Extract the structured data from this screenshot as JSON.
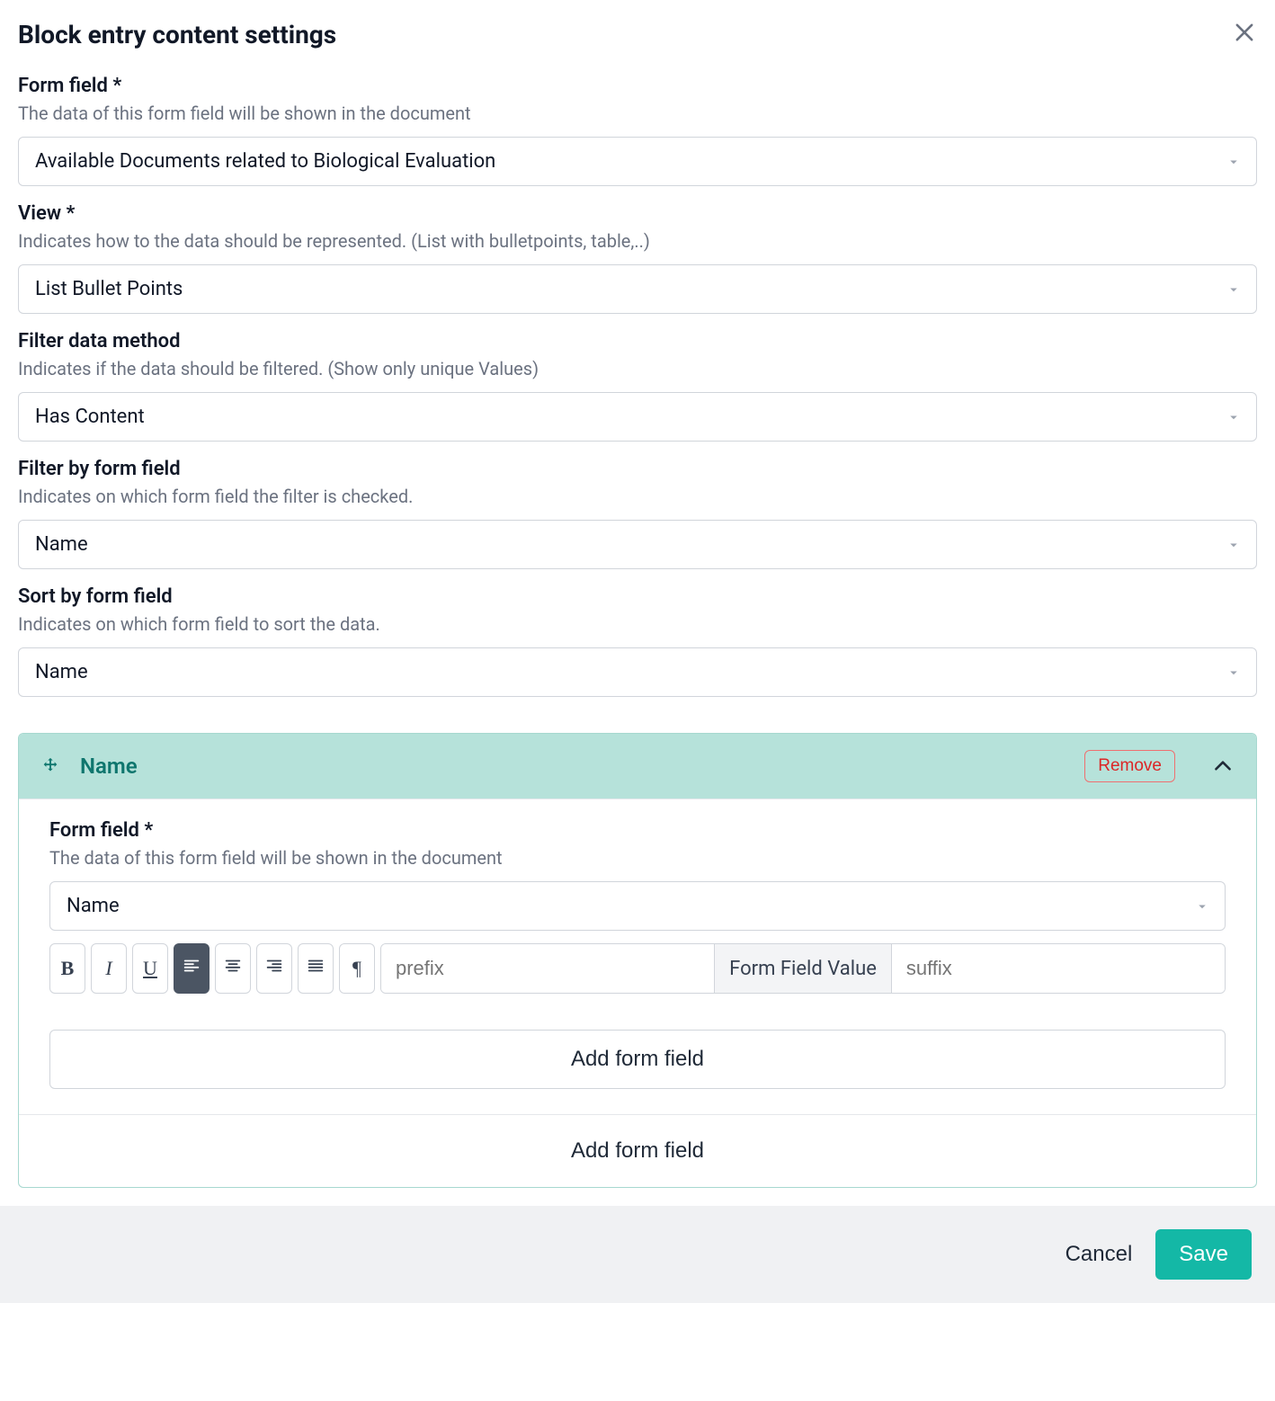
{
  "header": {
    "title": "Block entry content settings"
  },
  "fields": {
    "form_field": {
      "label": "Form field *",
      "desc": "The data of this form field will be shown in the document",
      "value": "Available Documents related to Biological Evaluation"
    },
    "view": {
      "label": "View *",
      "desc": "Indicates how to the data should be represented. (List with bulletpoints, table,..)",
      "value": "List Bullet Points"
    },
    "filter_method": {
      "label": "Filter data method",
      "desc": "Indicates if the data should be filtered. (Show only unique Values)",
      "value": "Has Content"
    },
    "filter_by": {
      "label": "Filter by form field",
      "desc": "Indicates on which form field the filter is checked.",
      "value": "Name"
    },
    "sort_by": {
      "label": "Sort by form field",
      "desc": "Indicates on which form field to sort the data.",
      "value": "Name"
    }
  },
  "panel": {
    "title": "Name",
    "remove_label": "Remove",
    "form_field": {
      "label": "Form field *",
      "desc": "The data of this form field will be shown in the document",
      "value": "Name"
    },
    "prefix_placeholder": "prefix",
    "ffv_label": "Form Field Value",
    "suffix_placeholder": "suffix",
    "add_inner": "Add form field"
  },
  "add_outer": "Add form field",
  "footer": {
    "cancel": "Cancel",
    "save": "Save"
  }
}
